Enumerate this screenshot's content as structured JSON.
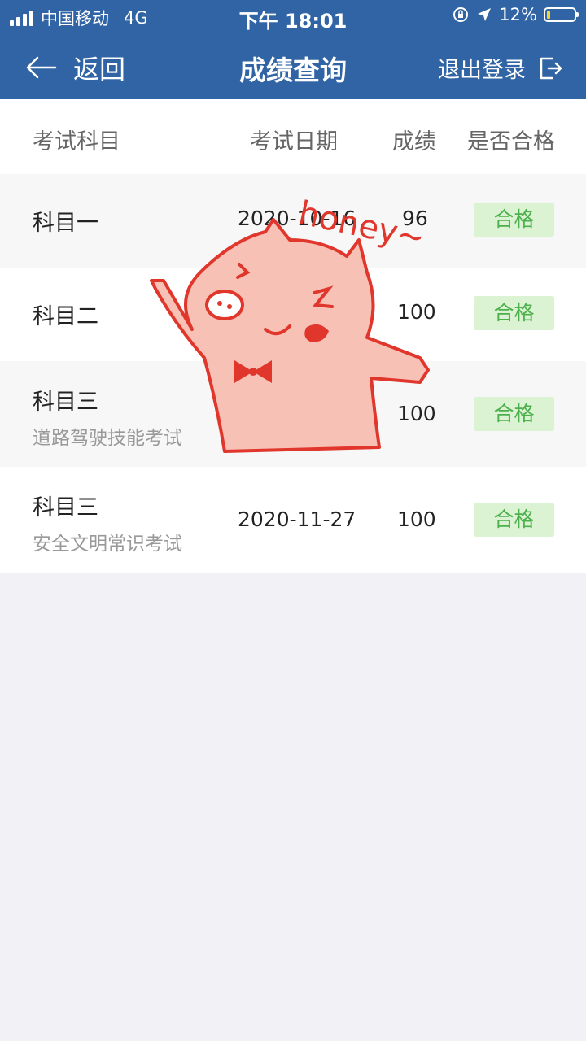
{
  "status_bar": {
    "carrier": "中国移动",
    "network": "4G",
    "time": "下午 18:01",
    "battery": "12%"
  },
  "navbar": {
    "back_label": "返回",
    "title": "成绩查询",
    "logout_label": "退出登录"
  },
  "table": {
    "headers": [
      "考试科目",
      "考试日期",
      "成绩",
      "是否合格"
    ],
    "rows": [
      {
        "subject": "科目一",
        "subtitle": "",
        "date": "2020-10-16",
        "score": "96",
        "result": "合格"
      },
      {
        "subject": "科目二",
        "subtitle": "",
        "date": "",
        "score": "100",
        "result": "合格"
      },
      {
        "subject": "科目三",
        "subtitle": "道路驾驶技能考试",
        "date": "",
        "score": "100",
        "result": "合格"
      },
      {
        "subject": "科目三",
        "subtitle": "安全文明常识考试",
        "date": "2020-11-27",
        "score": "100",
        "result": "合格"
      }
    ]
  },
  "sticker": {
    "text": "honey~",
    "colors": {
      "outline": "#e0362c",
      "fill": "#f8c1b6"
    }
  },
  "colors": {
    "brand": "#3064a5",
    "pass_badge_bg": "#dbf3d2",
    "pass_badge_text": "#4cb04c"
  }
}
